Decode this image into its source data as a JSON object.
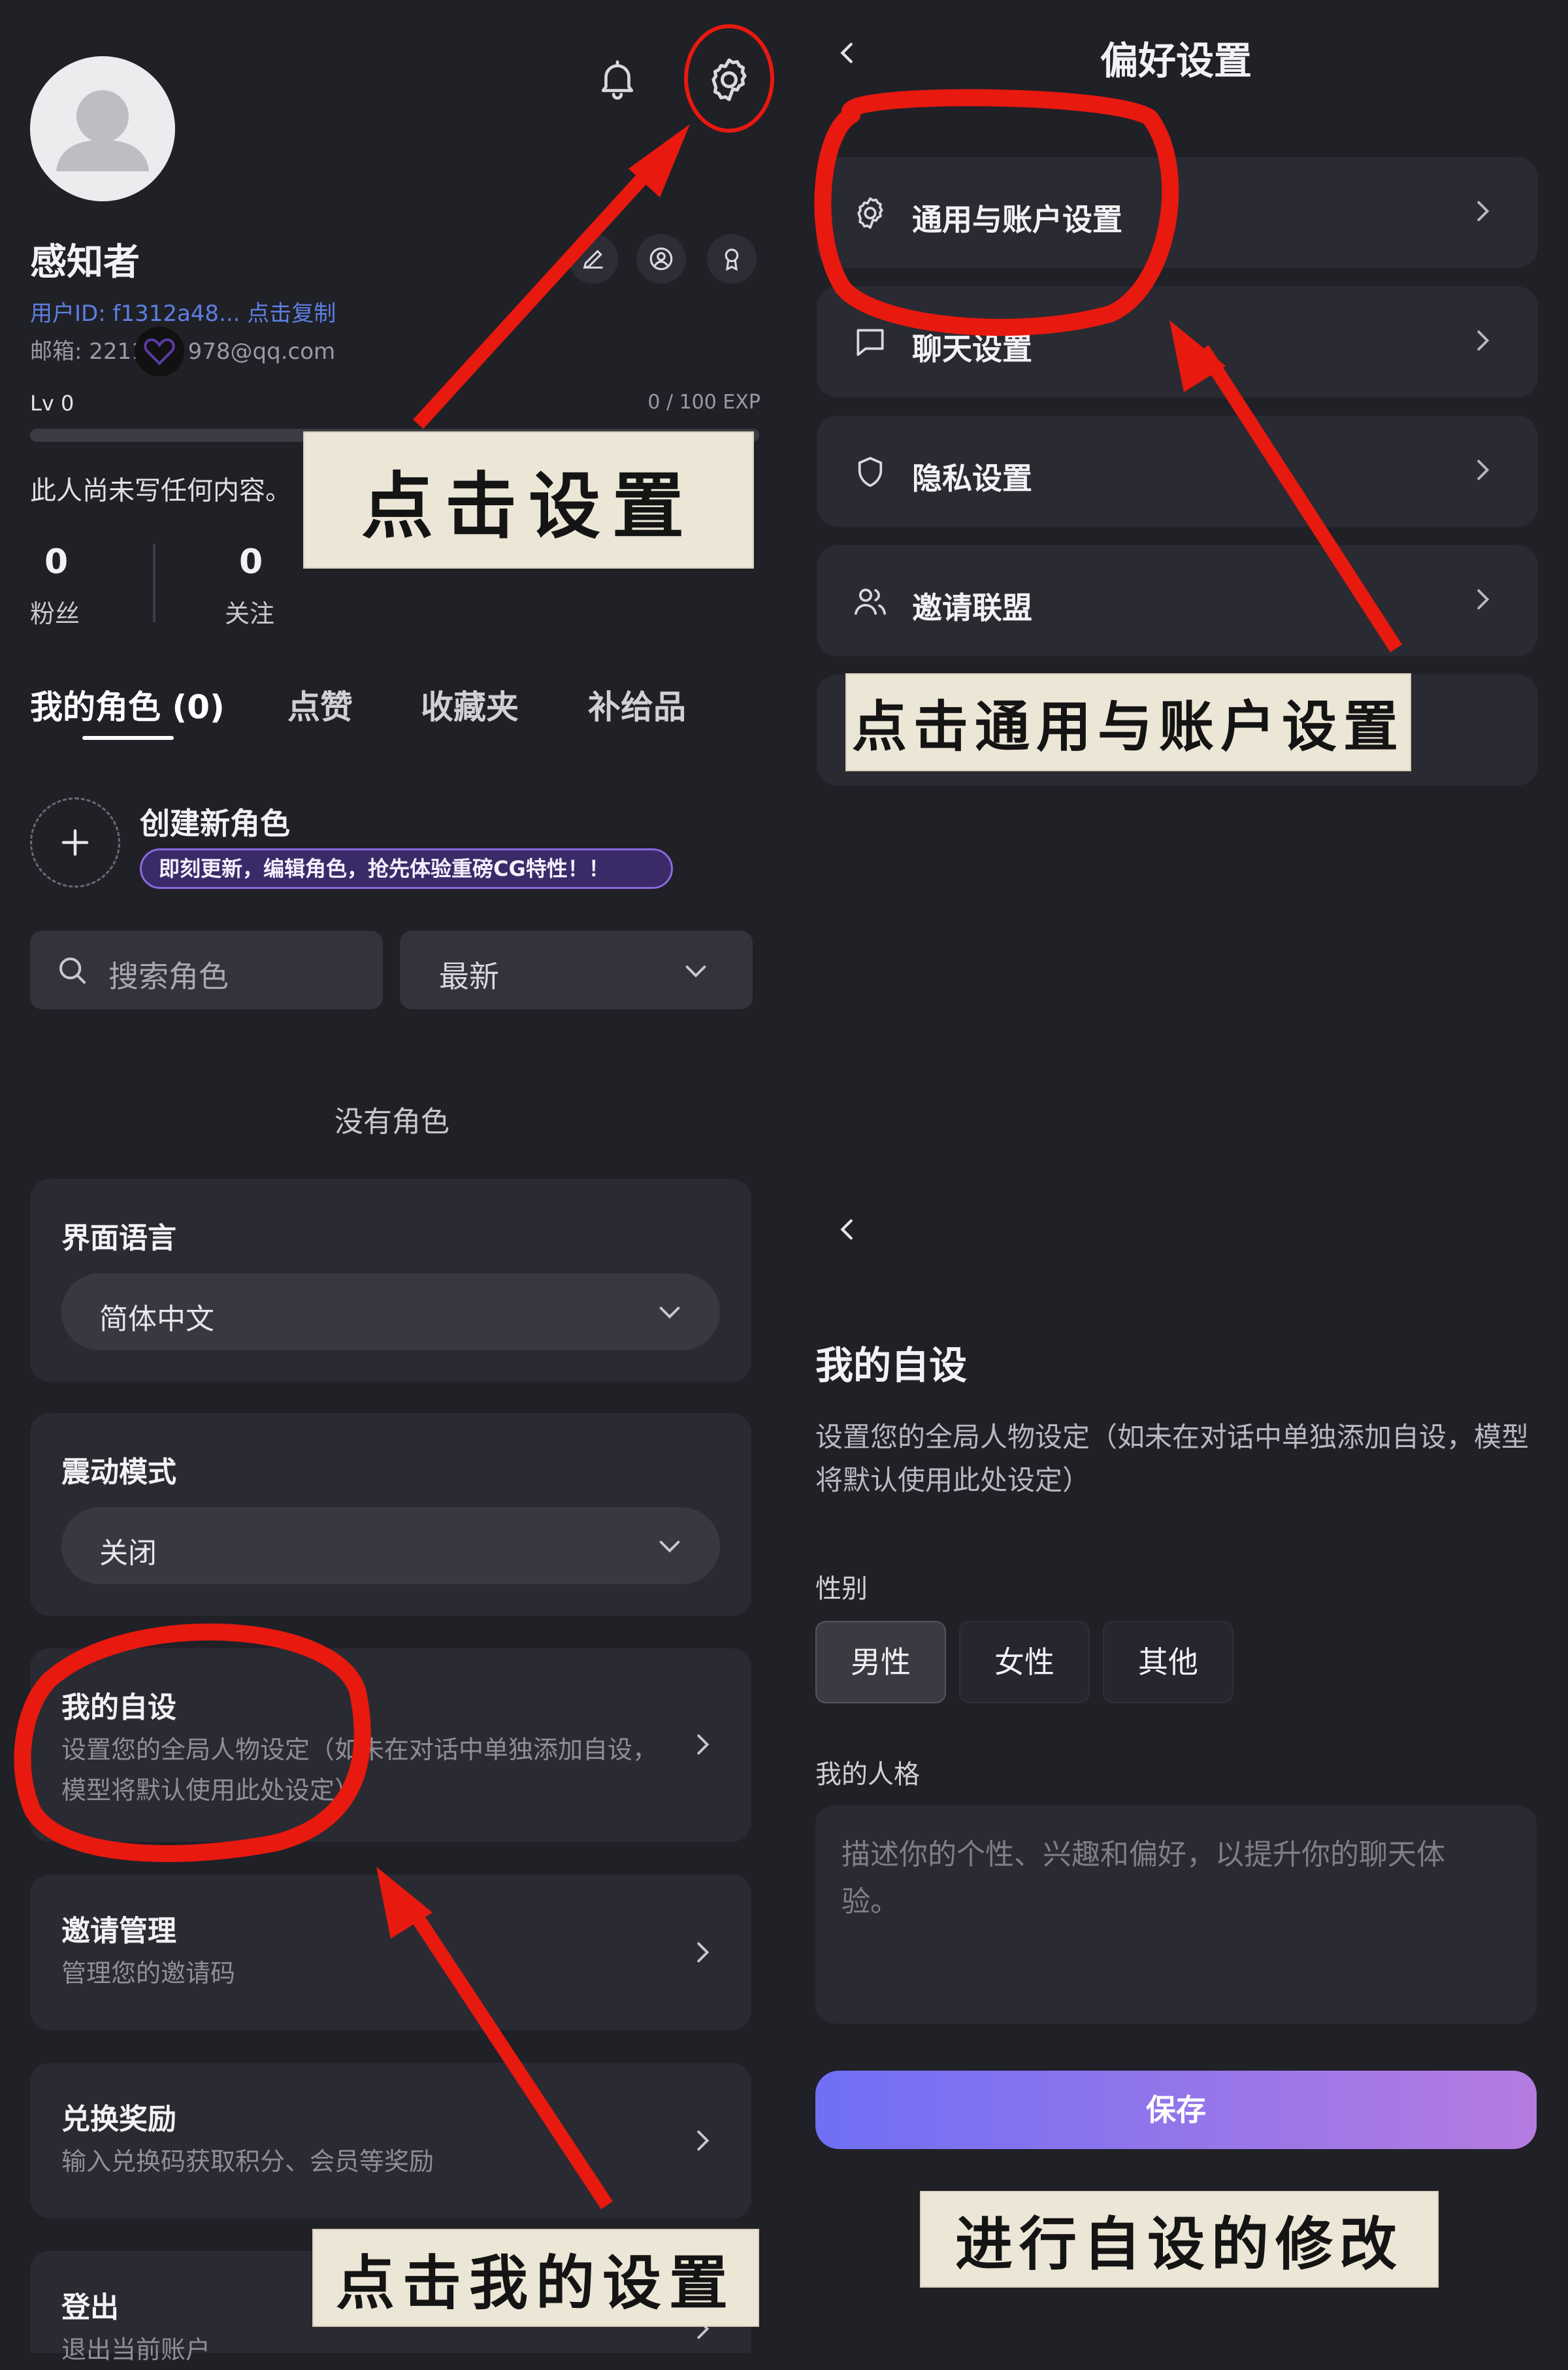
{
  "profile": {
    "name": "感知者",
    "user_id": "用户ID: f1312a48... 点击复制",
    "email": "邮箱: 2211      978@qq.com",
    "level": "Lv 0",
    "exp": "0 / 100 EXP",
    "level_progress": 0,
    "bio": "此人尚未写任何内容。",
    "followers_count": "0",
    "followers_label": "粉丝",
    "following_count": "0",
    "following_label": "关注"
  },
  "tabs": [
    "我的角色 (0)",
    "点赞",
    "收藏夹",
    "补给品"
  ],
  "create": {
    "title": "创建新角色",
    "banner": "即刻更新，编辑角色，抢先体验重磅CG特性！！"
  },
  "search": {
    "placeholder": "搜索角色"
  },
  "sort": {
    "value": "最新"
  },
  "empty": "没有角色",
  "settings_cards": {
    "language": {
      "title": "界面语言",
      "value": "简体中文"
    },
    "vibration": {
      "title": "震动模式",
      "value": "关闭"
    },
    "persona": {
      "title": "我的自设",
      "desc": "设置您的全局人物设定（如未在对话中单独添加自设，模型将默认使用此处设定）"
    },
    "invite": {
      "title": "邀请管理",
      "desc": "管理您的邀请码"
    },
    "redeem": {
      "title": "兑换奖励",
      "desc": "输入兑换码获取积分、会员等奖励"
    },
    "logout": {
      "title": "登出",
      "desc": "退出当前账户"
    }
  },
  "preferences": {
    "title": "偏好设置",
    "items": [
      "通用与账户设置",
      "聊天设置",
      "隐私设置",
      "邀请联盟"
    ]
  },
  "persona_page": {
    "title": "我的自设",
    "desc": "设置您的全局人物设定（如未在对话中单独添加自设，模型将默认使用此处设定）",
    "gender_label": "性别",
    "genders": [
      "男性",
      "女性",
      "其他"
    ],
    "selected_gender": "男性",
    "personality_label": "我的人格",
    "personality_placeholder": "描述你的个性、兴趣和偏好，以提升你的聊天体验。",
    "save": "保存"
  },
  "annotations": {
    "click_settings": "点击设置",
    "click_general": "点击通用与账户设置",
    "click_persona": "点击我的设置",
    "edit_persona": "进行自设的修改"
  },
  "colors": {
    "background": "#202027",
    "card": "#2a2a32",
    "accent_link": "#5d7fe0",
    "annotation_red": "#e8190f",
    "save_gradient_start": "#6f6ff5",
    "save_gradient_end": "#b57be0",
    "note_paper": "#ece6d7"
  },
  "icons": [
    "bell-icon",
    "gear-icon",
    "edit-icon",
    "user-circle-icon",
    "badge-icon",
    "plus-icon",
    "search-icon",
    "chevron-down-icon",
    "chevron-right-icon",
    "back-icon",
    "chat-icon",
    "shield-icon",
    "users-icon"
  ]
}
